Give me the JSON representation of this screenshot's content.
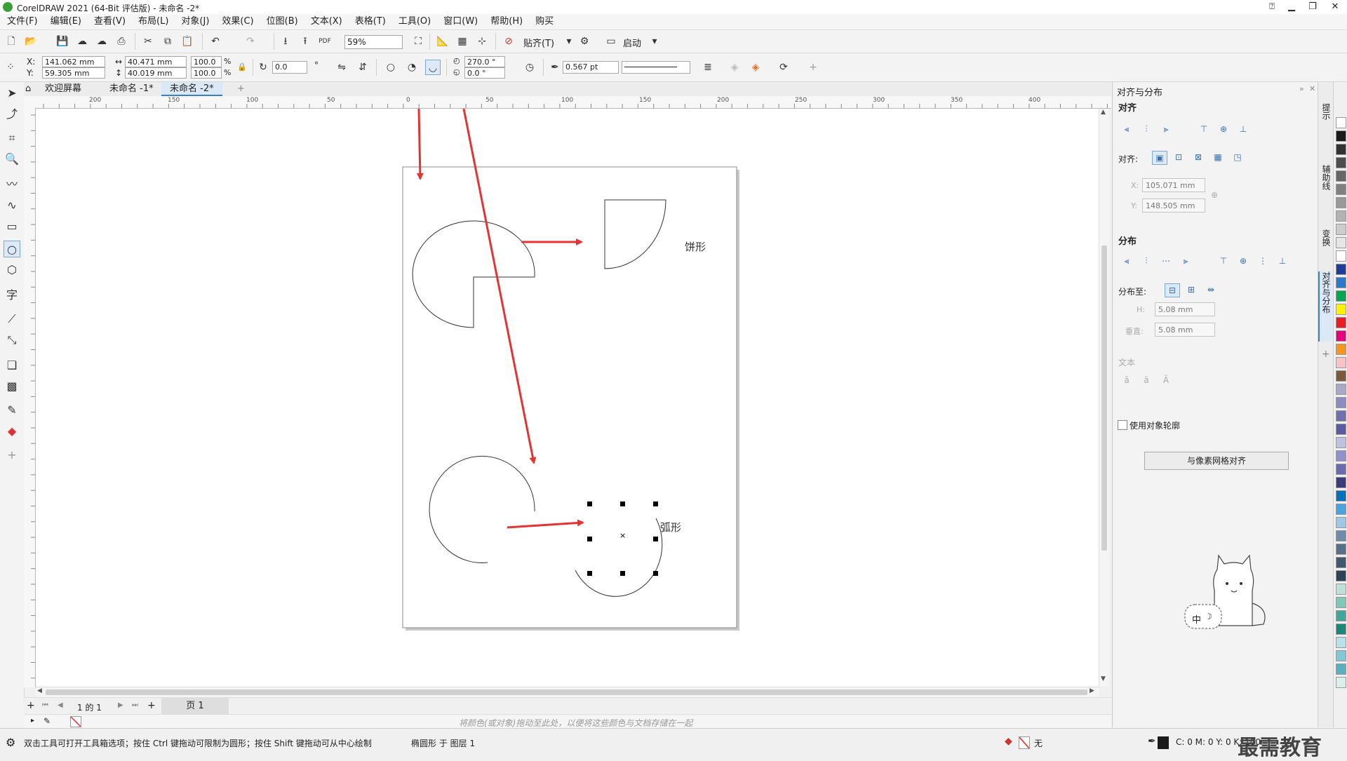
{
  "titlebar": {
    "title": "CorelDRAW 2021 (64-Bit 评估版) - 未命名 -2*",
    "min": "▁",
    "restore": "❐",
    "close": "✕",
    "help": "⍰"
  },
  "menu": [
    "文件(F)",
    "编辑(E)",
    "查看(V)",
    "布局(L)",
    "对象(J)",
    "效果(C)",
    "位图(B)",
    "文本(X)",
    "表格(T)",
    "工具(O)",
    "窗口(W)",
    "帮助(H)",
    "购买"
  ],
  "toolbar": {
    "zoom": "59%",
    "snap_label": "贴齐(T)",
    "launch_label": "启动",
    "pdf": "PDF"
  },
  "props": {
    "x_label": "X:",
    "y_label": "Y:",
    "x_value": "141.062 mm",
    "y_value": "59.305 mm",
    "w_value": "40.471 mm",
    "h_value": "40.019 mm",
    "sx": "100.0",
    "sy": "100.0",
    "pct": "%",
    "rotation": "0.0",
    "deg": "°",
    "start_angle": "270.0 °",
    "end_angle": "0.0 °",
    "outline": "0.567 pt"
  },
  "doc_tabs": {
    "home": "欢迎屏幕",
    "tab1": "未命名 -1*",
    "tab2": "未命名 -2*",
    "add": "+"
  },
  "hruler_ticks": [
    "200",
    "150",
    "100",
    "50",
    "0",
    "50",
    "100",
    "150",
    "200",
    "250",
    "300",
    "350",
    "400"
  ],
  "canvas": {
    "pie_label": "饼形",
    "arc_label": "弧形",
    "center_mark": "×"
  },
  "page_nav": {
    "page_info": "1 的 1",
    "page_tab": "页 1"
  },
  "colorbar": {
    "hint": "将颜色(或对象)拖动至此处，以便将这些颜色与文档存储在一起"
  },
  "docker": {
    "title": "对齐与分布",
    "align_header": "对齐",
    "align_to_label": "对齐:",
    "x_label": "X:",
    "x_value": "105.071 mm",
    "y_label": "Y:",
    "y_value": "148.505 mm",
    "distribute_header": "分布",
    "distribute_to_label": "分布至:",
    "h_label": "H:",
    "h_value": "5.08 mm",
    "v_label": "垂直:",
    "v_value": "5.08 mm",
    "text_header": "文本",
    "use_outline_label": "使用对象轮廓",
    "pixel_grid_button": "与像素网格对齐"
  },
  "docker_tabs": [
    "提示",
    "辅助线",
    "变换",
    "对齐与分布"
  ],
  "palette": [
    "#ffffff",
    "#1a1a1a",
    "#333333",
    "#4d4d4d",
    "#666666",
    "#808080",
    "#999999",
    "#b3b3b3",
    "#cccccc",
    "#e6e6e6",
    "#ffffff",
    "#1f3c9b",
    "#2b7ac9",
    "#00a650",
    "#fff200",
    "#ed1c24",
    "#e6007e",
    "#f7941d",
    "#f9c2c7",
    "#7b5a3c",
    "#a8a8c8",
    "#8c8cc0",
    "#7070b0",
    "#5a5aa0",
    "#c0c0e0",
    "#9090d0",
    "#6a6ab0",
    "#3c3c78",
    "#0072bc",
    "#4aa3df",
    "#9fc7e6",
    "#6c8ca8",
    "#557088",
    "#3f5a70",
    "#2b4458",
    "#bfe0d8",
    "#7fc8b8",
    "#40a898",
    "#1a8878",
    "#b8e0e8",
    "#80c8d8",
    "#58b0c0",
    "#d8f0e8"
  ],
  "status": {
    "hint": "双击工具可打开工具箱选项；按住 Ctrl 键拖动可限制为圆形；按住 Shift 键拖动可从中心绘制",
    "object": "椭圆形 于 图层 1",
    "fill": "无",
    "cmyk": "C: 0 M: 0 Y: 0 K: 100"
  },
  "watermark": "最需教育",
  "sticker": {
    "text": "中",
    "moon": "☽"
  }
}
